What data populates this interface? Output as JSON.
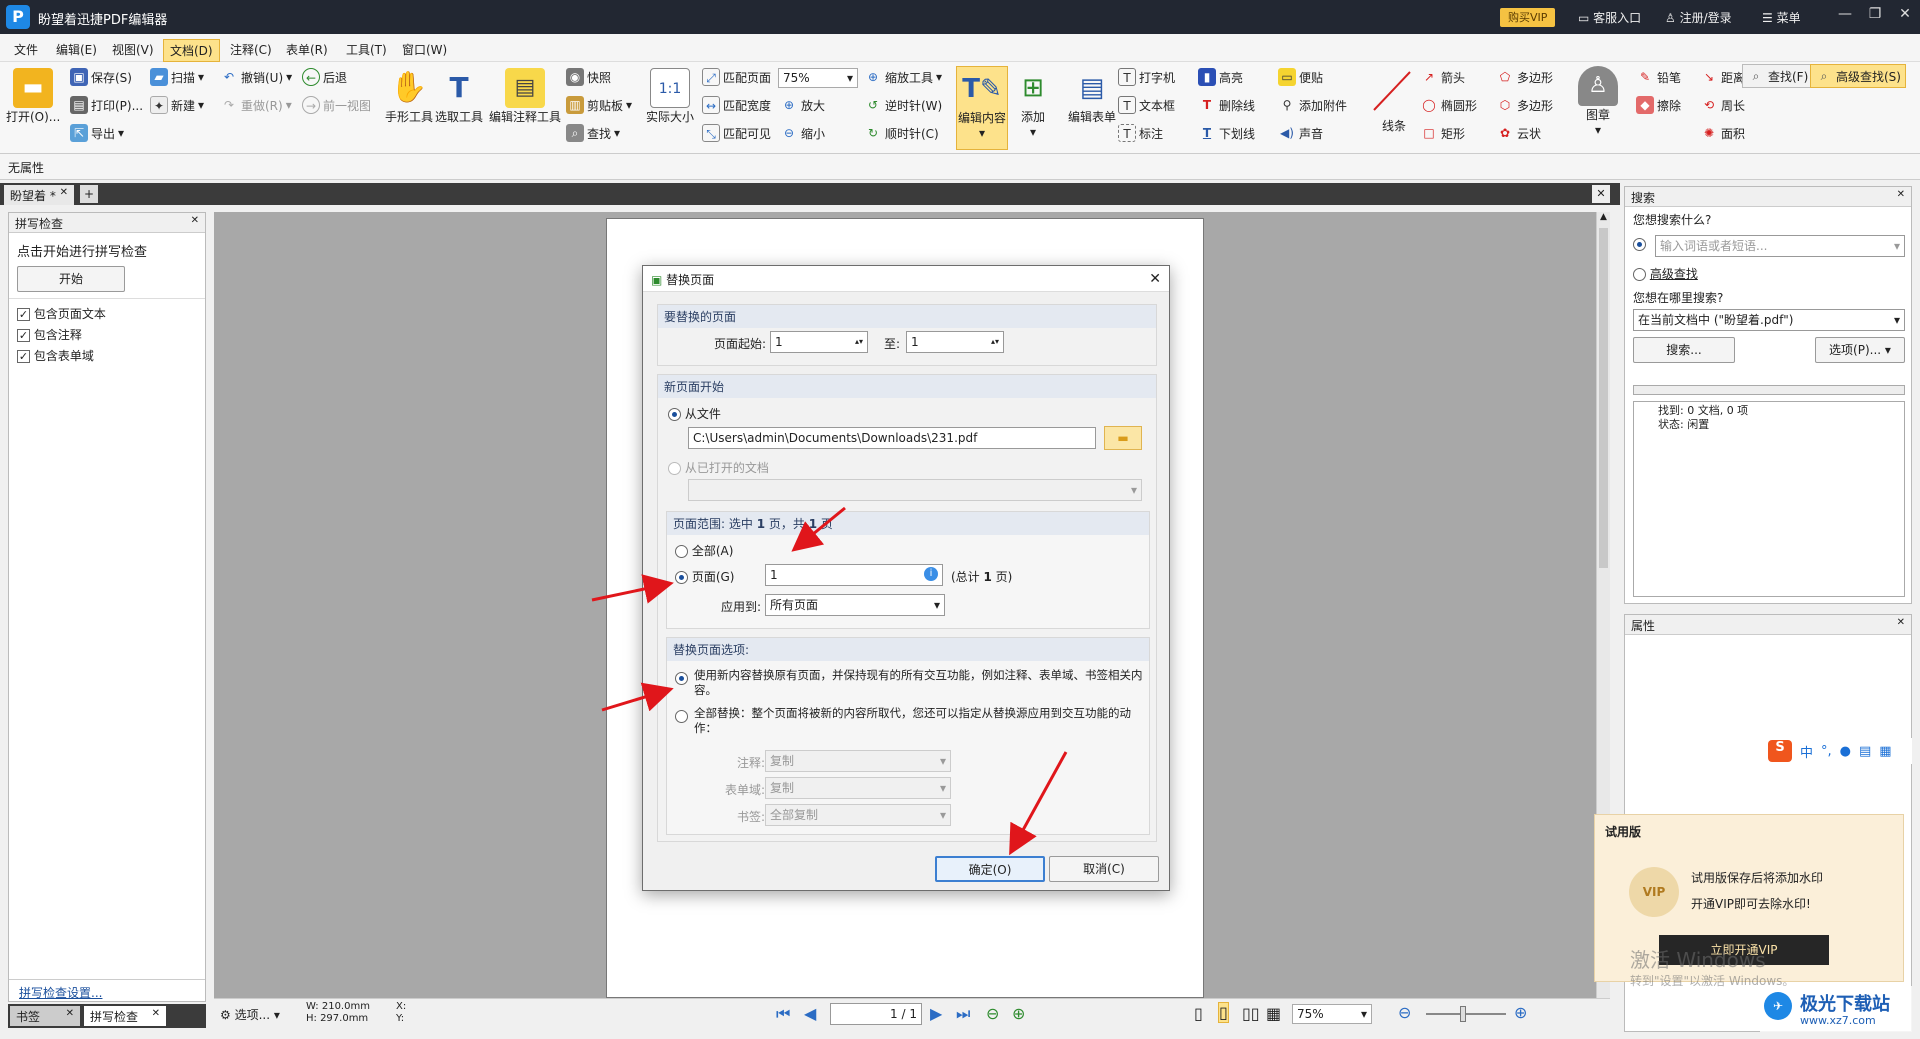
{
  "app": {
    "title": "盼望着迅捷PDF编辑器",
    "buy_vip": "购买VIP",
    "service": "客服入口",
    "login": "注册/登录",
    "menu": "菜单"
  },
  "menu": [
    "文件",
    "编辑(E)",
    "视图(V)",
    "文档(D)",
    "注释(C)",
    "表单(R)",
    "工具(T)",
    "窗口(W)"
  ],
  "ribbon": {
    "open": "打开(O)...",
    "save": "保存(S)",
    "print": "打印(P)...",
    "export": "导出",
    "scan": "扫描",
    "new": "新建",
    "undo": "撤销(U)",
    "redo": "重做(R)",
    "back": "后退",
    "prev_view": "前一视图",
    "hand": "手形工具",
    "select_tool": "选取工具",
    "edit_annot": "编辑注释工具",
    "snapshot": "快照",
    "clipboard": "剪贴板",
    "find": "查找",
    "actual": "实际大小",
    "fit_page": "匹配页面",
    "fit_width": "匹配宽度",
    "fit_visible": "匹配可见",
    "zoom": "75%",
    "zoom_tool": "缩放工具",
    "zoom_in": "放大",
    "zoom_out": "缩小",
    "ccw": "逆时针(W)",
    "cw": "顺时针(C)",
    "edit_content": "编辑内容",
    "add": "添加",
    "edit_form": "编辑表单",
    "typewriter": "打字机",
    "textbox": "文本框",
    "callout": "标注",
    "highlight": "高亮",
    "strikeout": "删除线",
    "underline": "下划线",
    "note": "便贴",
    "attach": "添加附件",
    "sound": "声音",
    "line": "线条",
    "arrow": "箭头",
    "ellipse": "椭圆形",
    "rect": "矩形",
    "polygon": "多边形",
    "polyline": "多边形",
    "cloud": "云状",
    "stamp": "图章",
    "pencil": "铅笔",
    "eraser": "擦除",
    "distance": "距离",
    "perimeter": "周长",
    "area": "面积",
    "search": "查找(F)",
    "adv_search": "高级查找(S)"
  },
  "prop_bar": "无属性",
  "doc_tab": "盼望着 *",
  "spell": {
    "title": "拼写检查",
    "hint": "点击开始进行拼写检查",
    "start": "开始",
    "options": [
      {
        "label": "包含页面文本",
        "checked": true
      },
      {
        "label": "包含注释",
        "checked": true
      },
      {
        "label": "包含表单域",
        "checked": true
      }
    ],
    "settings_link": "拼写检查设置..."
  },
  "bottom_tabs": [
    "书签",
    "拼写检查"
  ],
  "dialog": {
    "title": "替换页面",
    "section1": "要替换的页面",
    "start_label": "页面起始:",
    "start_val": "1",
    "to_label": "至:",
    "to_val": "1",
    "section2": "新页面开始",
    "from_file": "从文件",
    "file_path": "C:\\Users\\admin\\Documents\\Downloads\\231.pdf",
    "from_open": "从已打开的文档",
    "range_prefix": "页面范围: 选中 ",
    "range_sel": "1",
    "range_mid": " 页，共 ",
    "range_total": "1",
    "range_suffix": " 页",
    "all": "全部(A)",
    "pages": "页面(G)",
    "pages_val": "1",
    "total_pre": "(总计 ",
    "total_n": "1",
    "total_post": " 页)",
    "apply_to": "应用到:",
    "apply_val": "所有页面",
    "section3": "替换页面选项:",
    "opt1": "使用新内容替换原有页面，并保持现有的所有交互功能，例如注释、表单域、书签相关内容。",
    "opt2": "全部替换：整个页面将被新的内容所取代，您还可以指定从替换源应用到交互功能的动作：",
    "annot_label": "注释:",
    "annot_val": "复制",
    "form_label": "表单域:",
    "form_val": "复制",
    "bm_label": "书签:",
    "bm_val": "全部复制",
    "ok": "确定(O)",
    "cancel": "取消(C)"
  },
  "search_panel": {
    "title": "搜索",
    "what": "您想搜索什么?",
    "placeholder": "输入词语或者短语...",
    "advanced": "高级查找",
    "where": "您想在哪里搜索?",
    "where_val": "在当前文档中 (\"盼望着.pdf\")",
    "search_btn": "搜索...",
    "options_btn": "选项(P)...",
    "found": "找到: 0 文档, 0 项",
    "status": "状态: 闲置"
  },
  "props_panel": {
    "title": "属性"
  },
  "trial": {
    "title": "试用版",
    "line1": "试用版保存后将添加水印",
    "line2": "开通VIP即可去除水印!",
    "btn": "立即开通VIP",
    "vip": "VIP"
  },
  "watermark": {
    "l1": "激活 Windows",
    "l2": "转到\"设置\"以激活 Windows。"
  },
  "ime": [
    "中",
    "°,",
    "🎤",
    "⌨",
    "▦"
  ],
  "status": {
    "options": "选项...",
    "w": "W: 210.0mm",
    "h": "H: 297.0mm",
    "x": "X:",
    "y": "Y:",
    "page": "1 / 1",
    "zoom": "75%"
  },
  "brand": {
    "name": "极光下载站",
    "url": "www.xz7.com"
  }
}
